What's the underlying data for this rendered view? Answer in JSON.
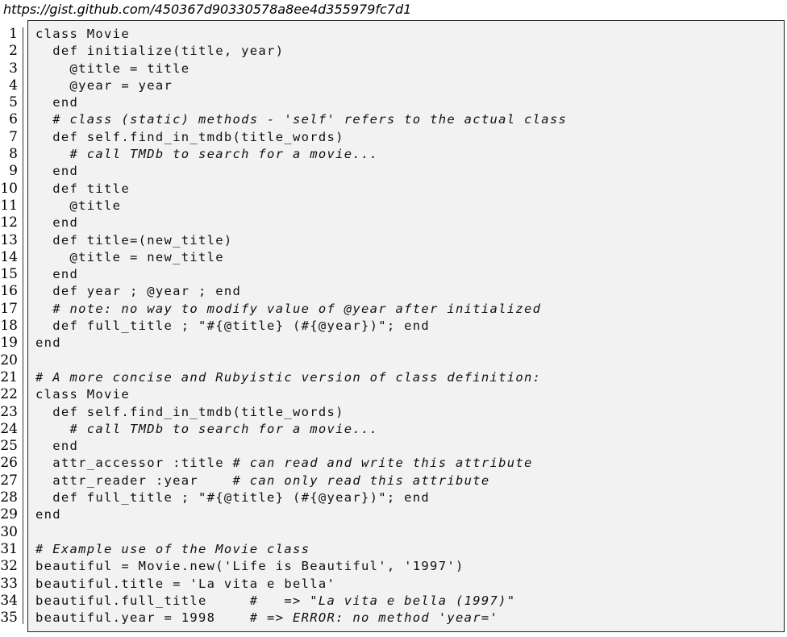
{
  "header": {
    "url": "https://gist.github.com/450367d90330578a8ee4d355979fc7d1"
  },
  "code_lines": [
    {
      "n": "1",
      "code": "class Movie",
      "comment": ""
    },
    {
      "n": "2",
      "code": "  def initialize(title, year)",
      "comment": ""
    },
    {
      "n": "3",
      "code": "    @title = title",
      "comment": ""
    },
    {
      "n": "4",
      "code": "    @year = year",
      "comment": ""
    },
    {
      "n": "5",
      "code": "  end",
      "comment": ""
    },
    {
      "n": "6",
      "code": "  ",
      "comment": "# class (static) methods - 'self' refers to the actual class"
    },
    {
      "n": "7",
      "code": "  def self.find_in_tmdb(title_words)",
      "comment": ""
    },
    {
      "n": "8",
      "code": "    ",
      "comment": "# call TMDb to search for a movie..."
    },
    {
      "n": "9",
      "code": "  end",
      "comment": ""
    },
    {
      "n": "10",
      "code": "  def title",
      "comment": ""
    },
    {
      "n": "11",
      "code": "    @title",
      "comment": ""
    },
    {
      "n": "12",
      "code": "  end",
      "comment": ""
    },
    {
      "n": "13",
      "code": "  def title=(new_title)",
      "comment": ""
    },
    {
      "n": "14",
      "code": "    @title = new_title",
      "comment": ""
    },
    {
      "n": "15",
      "code": "  end",
      "comment": ""
    },
    {
      "n": "16",
      "code": "  def year ; @year ; end",
      "comment": ""
    },
    {
      "n": "17",
      "code": "  ",
      "comment": "# note: no way to modify value of @year after initialized"
    },
    {
      "n": "18",
      "code": "  def full_title ; \"#{@title} (#{@year})\"; end",
      "comment": ""
    },
    {
      "n": "19",
      "code": "end",
      "comment": ""
    },
    {
      "n": "20",
      "code": "",
      "comment": ""
    },
    {
      "n": "21",
      "code": "",
      "comment": "# A more concise and Rubyistic version of class definition:"
    },
    {
      "n": "22",
      "code": "class Movie",
      "comment": ""
    },
    {
      "n": "23",
      "code": "  def self.find_in_tmdb(title_words)",
      "comment": ""
    },
    {
      "n": "24",
      "code": "    ",
      "comment": "# call TMDb to search for a movie..."
    },
    {
      "n": "25",
      "code": "  end",
      "comment": ""
    },
    {
      "n": "26",
      "code": "  attr_accessor :title ",
      "comment": "# can read and write this attribute"
    },
    {
      "n": "27",
      "code": "  attr_reader :year    ",
      "comment": "# can only read this attribute"
    },
    {
      "n": "28",
      "code": "  def full_title ; \"#{@title} (#{@year})\"; end",
      "comment": ""
    },
    {
      "n": "29",
      "code": "end",
      "comment": ""
    },
    {
      "n": "30",
      "code": "",
      "comment": ""
    },
    {
      "n": "31",
      "code": "",
      "comment": "# Example use of the Movie class"
    },
    {
      "n": "32",
      "code": "beautiful = Movie.new('Life is Beautiful', '1997')",
      "comment": ""
    },
    {
      "n": "33",
      "code": "beautiful.title = 'La vita e bella'",
      "comment": ""
    },
    {
      "n": "34",
      "code": "beautiful.full_title     ",
      "comment": "#   => \"La vita e bella (1997)\""
    },
    {
      "n": "35",
      "code": "beautiful.year = 1998    ",
      "comment": "# => ERROR: no method 'year='"
    }
  ]
}
